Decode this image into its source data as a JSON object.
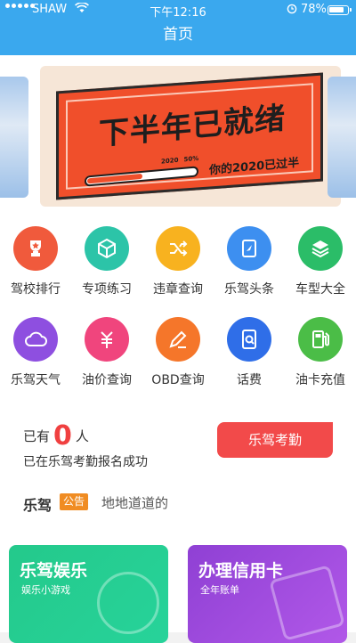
{
  "status_bar": {
    "carrier": "SHAW",
    "time": "下午12:16",
    "battery": "78%"
  },
  "nav": {
    "title": "首页"
  },
  "banner": {
    "headline": "下半年已就绪",
    "subtitle": "你的2020已过半",
    "progress_year": "2020",
    "progress_label": "50%",
    "progress_value": 0.5
  },
  "grid": {
    "items": [
      {
        "label": "驾校排行",
        "icon": "trophy-icon",
        "color": "#f05a3c"
      },
      {
        "label": "专项练习",
        "icon": "cube-icon",
        "color": "#2cc4a8"
      },
      {
        "label": "违章查询",
        "icon": "shuffle-icon",
        "color": "#f8b21f"
      },
      {
        "label": "乐驾头条",
        "icon": "book-icon",
        "color": "#3d8ff0"
      },
      {
        "label": "车型大全",
        "icon": "car-icon",
        "color": "#2bbd68"
      },
      {
        "label": "乐驾天气",
        "icon": "cloud-icon",
        "color": "#8e4fe0"
      },
      {
        "label": "油价查询",
        "icon": "price-icon",
        "color": "#f0457d"
      },
      {
        "label": "OBD查询",
        "icon": "edit-icon",
        "color": "#f5762a"
      },
      {
        "label": "话费",
        "icon": "phone-icon",
        "color": "#2f6ee8"
      },
      {
        "label": "油卡充值",
        "icon": "fuel-icon",
        "color": "#4bbd47"
      }
    ]
  },
  "checkin": {
    "prefix": "已有",
    "count": "0",
    "suffix": "人",
    "desc": "已在乐驾考勤报名成功",
    "button": "乐驾考勤"
  },
  "notice": {
    "brand": "乐驾",
    "tag": "公告",
    "text": "地地道道的"
  },
  "cards": [
    {
      "title": "乐驾娱乐",
      "subtitle": "娱乐小游戏",
      "icon": "game-icon"
    },
    {
      "title": "办理信用卡",
      "subtitle": "全年账单",
      "icon": "credit-card-icon"
    }
  ]
}
